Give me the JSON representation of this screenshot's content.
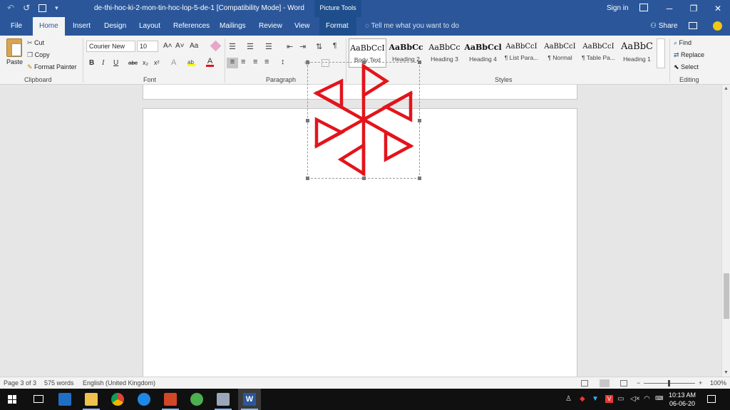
{
  "window": {
    "title": "de-thi-hoc-ki-2-mon-tin-hoc-lop-5-de-1 [Compatibility Mode] - Word",
    "contextual_tab_group": "Picture Tools",
    "sign_in": "Sign in",
    "controls": {
      "minimize": "─",
      "restore": "❐",
      "close": "✕"
    }
  },
  "quick_access": {
    "undo": "↶",
    "redo": "↺",
    "save": "💾",
    "customize": "▾"
  },
  "tabs": [
    "File",
    "Home",
    "Insert",
    "Design",
    "Layout",
    "References",
    "Mailings",
    "Review",
    "View",
    "Format"
  ],
  "active_tab": "Home",
  "tell_me": "Tell me what you want to do",
  "share": "Share",
  "clipboard": {
    "paste": "Paste",
    "cut": "Cut",
    "copy": "Copy",
    "format_painter": "Format Painter",
    "group": "Clipboard"
  },
  "font": {
    "name": "Courier New",
    "size": "10",
    "grow": "A˄",
    "shrink": "A˅",
    "change_case": "Aa",
    "bold": "B",
    "italic": "I",
    "underline": "U",
    "strike": "abc",
    "subscript": "x₂",
    "superscript": "x²",
    "group": "Font"
  },
  "paragraph": {
    "group": "Paragraph",
    "pilcrow": "¶"
  },
  "styles": {
    "group": "Styles",
    "items": [
      {
        "preview": "AaBbCcI",
        "name": "Body Text"
      },
      {
        "preview": "AaBbCc",
        "name": "Heading 2"
      },
      {
        "preview": "AaBbCc",
        "name": "Heading 3"
      },
      {
        "preview": "AaBbCcl",
        "name": "Heading 4"
      },
      {
        "preview": "AaBbCcI",
        "name": "¶ List Para..."
      },
      {
        "preview": "AaBbCcI",
        "name": "¶ Normal"
      },
      {
        "preview": "AaBbCcI",
        "name": "¶ Table Pa..."
      },
      {
        "preview": "AaBbC",
        "name": "Heading 1"
      }
    ]
  },
  "editing": {
    "find": "Find",
    "replace": "Replace",
    "select": "Select",
    "group": "Editing"
  },
  "status": {
    "page": "Page 3 of 3",
    "words": "575 words",
    "language": "English (United Kingdom)",
    "zoom": "100%",
    "zoom_minus": "−",
    "zoom_plus": "+"
  },
  "taskbar": {
    "time": "10:13 AM",
    "date": "06-06-20"
  },
  "colors": {
    "accent": "#2b579a",
    "shape": "#e3141b"
  }
}
